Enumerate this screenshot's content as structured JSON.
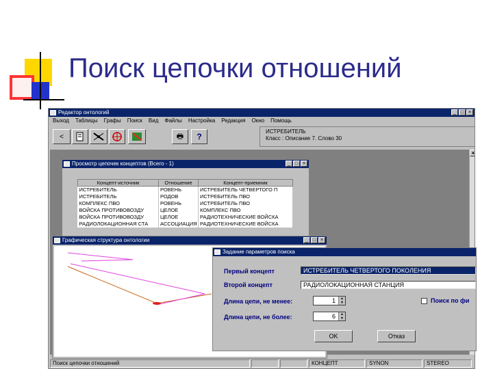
{
  "slide": {
    "title": "Поиск цепочки отношений"
  },
  "main_window": {
    "title": "Редактор онтологий",
    "min_btn": "_",
    "max_btn": "□",
    "close_btn": "×",
    "menu": [
      "Выход",
      "Таблицы",
      "Графы",
      "Поиск",
      "Вид",
      "Файлы",
      "Настройка",
      "Редакция",
      "Окно",
      "Помощь"
    ],
    "info_line1": "ИСТРЕБИТЕЛЬ",
    "info_line2": "Класс : Описание   7. Слово   30",
    "toolbar_print_glyph": "🖶",
    "toolbar_help_glyph": "?",
    "toolbar_back_glyph": "<",
    "status": [
      "Поиск цепочки отношений",
      "",
      "",
      "КОНЦЕПТ",
      "SYNON",
      "STEREO"
    ]
  },
  "concepts_window": {
    "title": "Просмотр цепочек концептов (Всего - 1)",
    "min_btn": "_",
    "max_btn": "□",
    "close_btn": "×",
    "columns": [
      "Концепт-источник",
      "Отношение",
      "Концепт-приемник"
    ],
    "rows": [
      [
        "ИСТРЕБИТЕЛЬ",
        "РОВЕНЬ",
        "ИСТРЕБИТЕЛЬ ЧЕТВЕРТОГО П"
      ],
      [
        "ИСТРЕБИТЕЛЬ",
        "РОДОВ",
        "ИСТРЕБИТЕЛЬ ПВО"
      ],
      [
        "КОМПЛЕКС ПВО",
        "РОВЕНЬ",
        "ИСТРЕБИТЕЛЬ ПВО"
      ],
      [
        "ВОЙСКА ПРОТИВОВОЗДУ",
        "ЦЕЛОЕ",
        "КОМПЛЕКС ПВО"
      ],
      [
        "ВОЙСКА ПРОТИВОВОЗДУ",
        "ЦЕЛОЕ",
        "РАДИОТЕХНИЧЕСКИЕ ВОЙСКА"
      ],
      [
        "РАДИОЛОКАЦИОННАЯ СТА",
        "АССОЦИАЦИЯ",
        "РАДИОТЕХНИЧЕСКИЕ ВОЙСКА"
      ]
    ]
  },
  "graph_window": {
    "title": "Графическая структура онтологии",
    "min_btn": "_",
    "max_btn": "□",
    "close_btn": "×"
  },
  "search_dialog": {
    "title": "Задание параметров поиска",
    "first_concept_label": "Первый концепт",
    "first_concept_value": "ИСТРЕБИТЕЛЬ ЧЕТВЕРТОГО ПОКОЛЕНИЯ",
    "second_concept_label": "Второй концепт",
    "second_concept_value": "РАДИОЛОКАЦИОННАЯ СТАНЦИЯ",
    "min_length_label": "Длина цепи, не менее:",
    "min_length_value": "1",
    "max_length_label": "Длина цепи, не более:",
    "max_length_value": "6",
    "search_checkbox_label": "Поиск по фи",
    "ok_label": "OK",
    "cancel_label": "Отказ"
  }
}
